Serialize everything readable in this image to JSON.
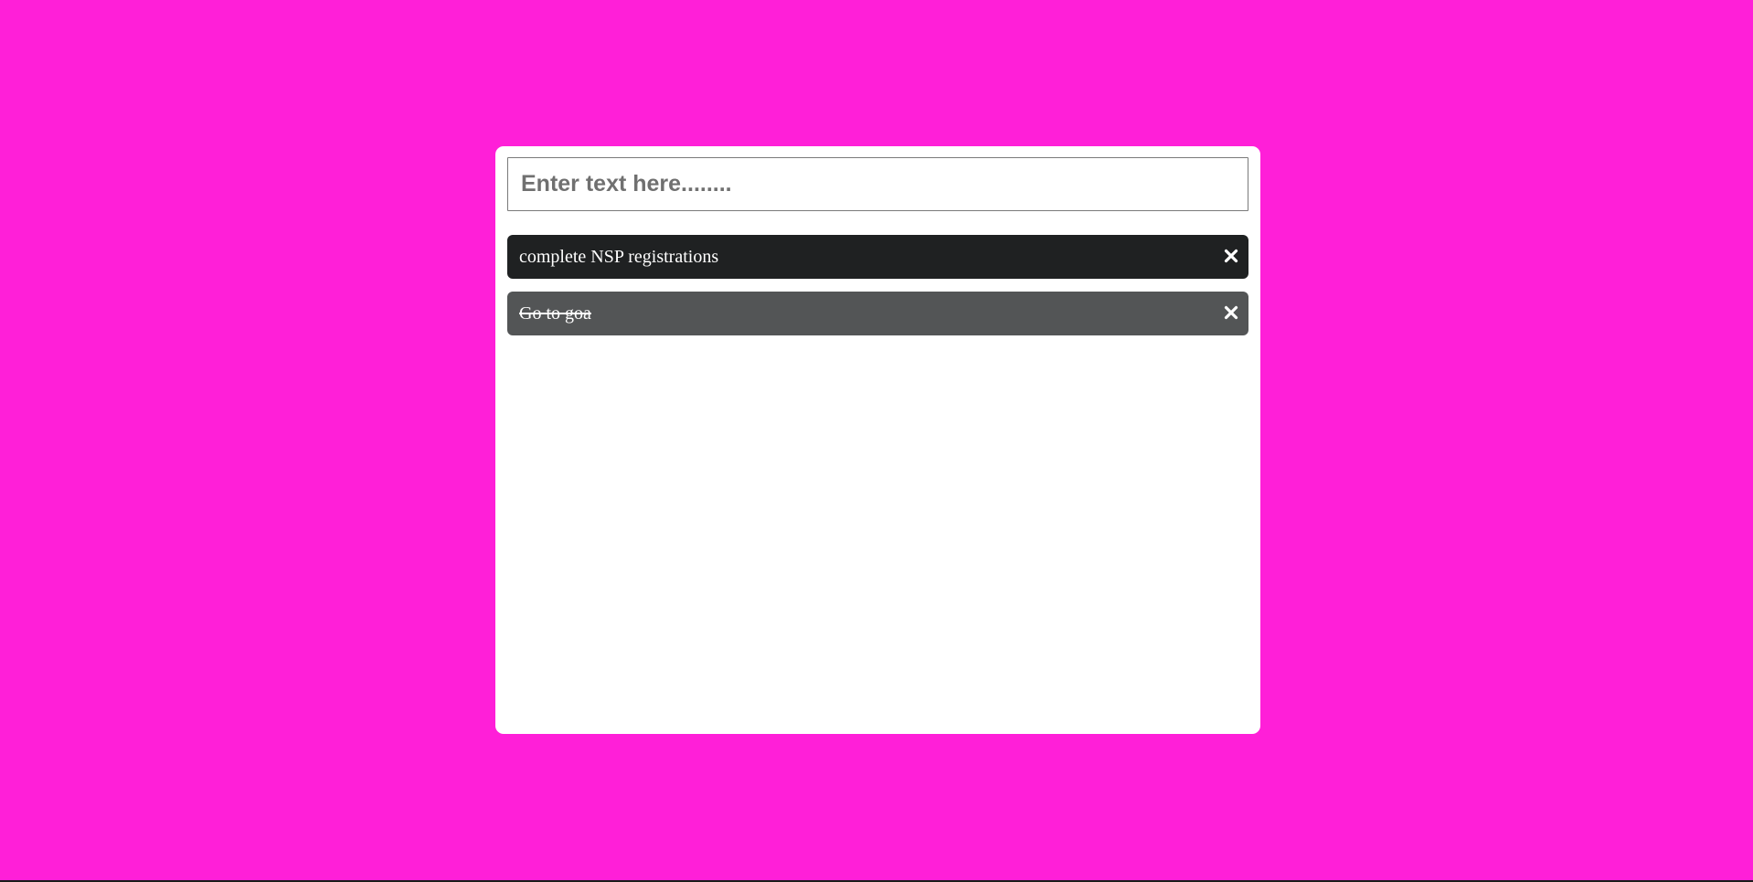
{
  "colors": {
    "background": "#ff1fd8",
    "card": "#ffffff",
    "item_active": "#1f2122",
    "item_done": "#535556",
    "text": "#ffffff"
  },
  "input": {
    "placeholder": "Enter text here........",
    "value": ""
  },
  "todos": [
    {
      "text": "complete NSP registrations",
      "done": false,
      "delete_icon": "close-icon"
    },
    {
      "text": "Go to goa",
      "done": true,
      "delete_icon": "close-icon"
    }
  ]
}
